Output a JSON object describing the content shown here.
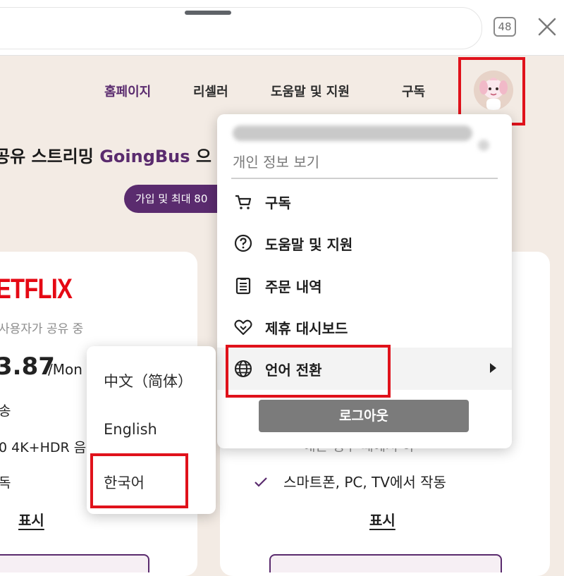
{
  "browser": {
    "tab_count": "48",
    "icons": [
      "tab-count-icon",
      "close-icon"
    ]
  },
  "nav": {
    "items": [
      {
        "label": "홈페이지",
        "active": true
      },
      {
        "label": "리셀러",
        "active": false
      },
      {
        "label": "도움말 및 지원",
        "active": false
      },
      {
        "label": "구독",
        "active": false
      }
    ],
    "avatar_icon": "avatar"
  },
  "hero": {
    "headline_prefix": "공유 스트리밍 ",
    "headline_brand": "GoingBus",
    "headline_suffix": " 으",
    "cta_label": "가입 및 최대 80"
  },
  "left_card": {
    "logo": "ETFLIX",
    "users_text": "사용자가 공유 중",
    "price": "3.87",
    "price_unit": "/Mon",
    "feature1": "송",
    "feature2": "0 4K+HDR 음",
    "feature3": "독",
    "show_label": "표시"
  },
  "right_card": {
    "feature_partial": "애는 생수 때에서 하",
    "feature": "스마트폰, PC, TV에서 작동",
    "show_label": "표시"
  },
  "account_menu": {
    "email": "appleorange2738@gmail.com",
    "profile_link": "개인 정보 보기",
    "items": [
      {
        "label": "구독",
        "icon": "cart-icon"
      },
      {
        "label": "도움말 및 지원",
        "icon": "help-circle-icon"
      },
      {
        "label": "주문 내역",
        "icon": "clipboard-list-icon"
      },
      {
        "label": "제휴 대시보드",
        "icon": "handshake-heart-icon"
      },
      {
        "label": "언어 전환",
        "icon": "globe-icon"
      }
    ],
    "logout_label": "로그아웃"
  },
  "language_menu": {
    "options": [
      "中文（简体）",
      "English",
      "한국어"
    ]
  },
  "colors": {
    "brand": "#5a2b6e",
    "highlight": "#e0121b",
    "netflix": "#e50914",
    "page_bg": "#f3ebe4"
  }
}
